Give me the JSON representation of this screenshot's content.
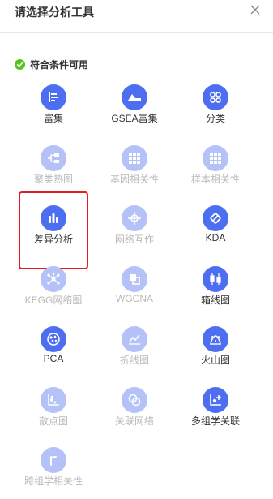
{
  "header": {
    "title": "请选择分析工具"
  },
  "section": {
    "label": "符合条件可用"
  },
  "tools": [
    {
      "label": "富集",
      "icon": "enrichment-icon",
      "enabled": true
    },
    {
      "label": "GSEA富集",
      "icon": "gsea-icon",
      "enabled": true
    },
    {
      "label": "分类",
      "icon": "classify-icon",
      "enabled": true
    },
    {
      "label": "聚类热图",
      "icon": "cluster-heatmap-icon",
      "enabled": false
    },
    {
      "label": "基因相关性",
      "icon": "gene-correlation-icon",
      "enabled": false
    },
    {
      "label": "样本相关性",
      "icon": "sample-correlation-icon",
      "enabled": false
    },
    {
      "label": "差异分析",
      "icon": "differential-analysis-icon",
      "enabled": true,
      "selected": true
    },
    {
      "label": "网络互作",
      "icon": "network-interaction-icon",
      "enabled": false
    },
    {
      "label": "KDA",
      "icon": "kda-icon",
      "enabled": true
    },
    {
      "label": "KEGG网络图",
      "icon": "kegg-network-icon",
      "enabled": false
    },
    {
      "label": "WGCNA",
      "icon": "wgcna-icon",
      "enabled": false
    },
    {
      "label": "箱线图",
      "icon": "boxplot-icon",
      "enabled": true
    },
    {
      "label": "PCA",
      "icon": "pca-icon",
      "enabled": true
    },
    {
      "label": "折线图",
      "icon": "line-chart-icon",
      "enabled": false
    },
    {
      "label": "火山图",
      "icon": "volcano-plot-icon",
      "enabled": true
    },
    {
      "label": "散点图",
      "icon": "scatter-plot-icon",
      "enabled": false
    },
    {
      "label": "关联网络",
      "icon": "association-network-icon",
      "enabled": false
    },
    {
      "label": "多组学关联",
      "icon": "multi-omics-icon",
      "enabled": true
    },
    {
      "label": "跨组学相关性",
      "icon": "cross-omics-icon",
      "enabled": false
    }
  ],
  "colors": {
    "accent": "#4e6ef2",
    "accent_disabled": "#b4c2f7",
    "check_green": "#52c41a",
    "selected_border": "#e02020"
  }
}
